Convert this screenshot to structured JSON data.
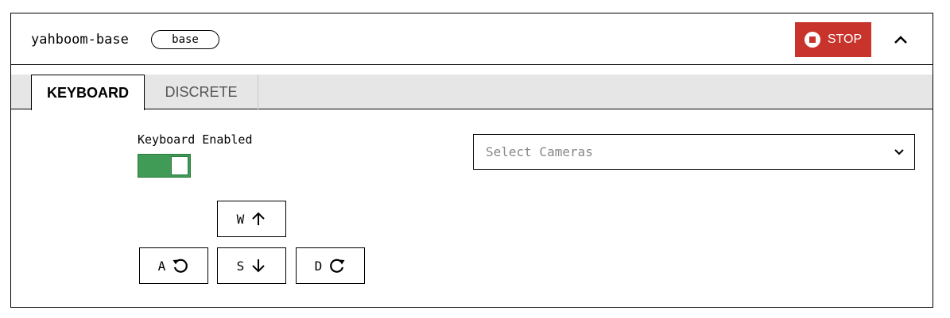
{
  "header": {
    "title": "yahboom-base",
    "badge": "base",
    "stop_label": "STOP",
    "stop_color": "#c8332c"
  },
  "tabs": [
    {
      "label": "KEYBOARD",
      "active": true
    },
    {
      "label": "DISCRETE",
      "active": false
    }
  ],
  "keyboard": {
    "toggle_label": "Keyboard Enabled",
    "enabled": true,
    "toggle_color": "#3f9b55",
    "keys": {
      "w": {
        "label": "W",
        "icon": "arrow-up-icon"
      },
      "a": {
        "label": "A",
        "icon": "rotate-ccw-icon"
      },
      "s": {
        "label": "S",
        "icon": "arrow-down-icon"
      },
      "d": {
        "label": "D",
        "icon": "rotate-cw-icon"
      }
    }
  },
  "cameras": {
    "placeholder": "Select Cameras",
    "icon": "chevron-down-icon"
  },
  "icons": {
    "stop": "stop-icon",
    "collapse": "chevron-up-icon"
  }
}
